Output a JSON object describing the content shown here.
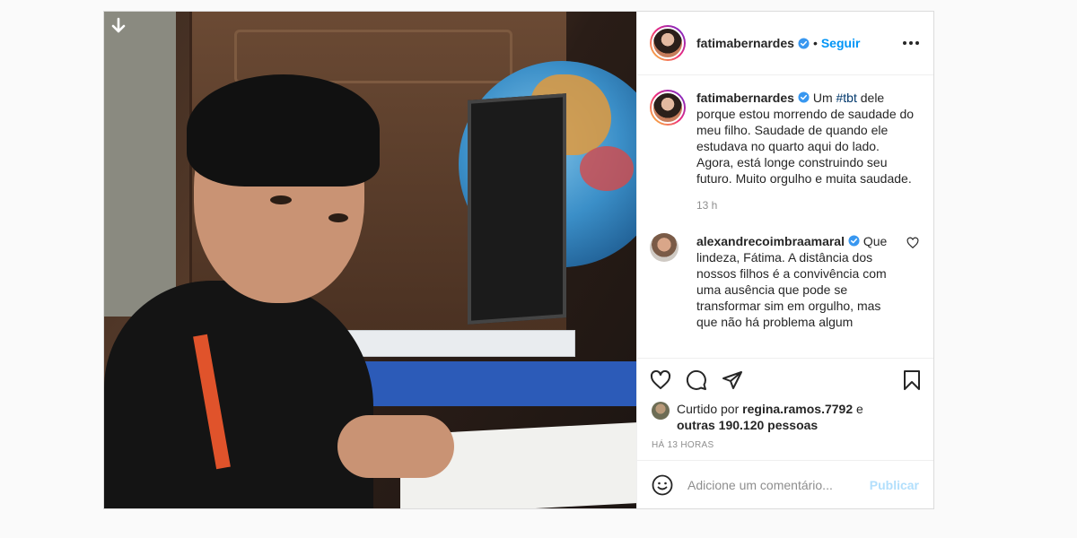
{
  "post": {
    "author": {
      "username": "fatimabernardes",
      "verified": true,
      "follow_label": "Seguir",
      "separator": "•"
    },
    "caption": {
      "username": "fatimabernardes",
      "text_before_hashtag": " Um ",
      "hashtag": "#tbt",
      "text_after_hashtag": " dele porque estou morrendo de saudade do meu filho. Saudade de quando ele estudava no quarto aqui do lado. Agora, está longe construindo seu futuro. Muito orgulho e muita saudade.",
      "time": "13 h"
    },
    "comments": [
      {
        "username": "alexandrecoimbraamaral",
        "verified": true,
        "text": " Que lindeza, Fátima. A distância dos nossos filhos é a convivência com uma ausência que pode se transformar sim em orgulho, mas que não há problema algum"
      }
    ],
    "likes": {
      "prefix": "Curtido por ",
      "user": "regina.ramos.7792",
      "connector": " e",
      "others": "outras 190.120 pessoas"
    },
    "posted_ago": "HÁ 13 HORAS",
    "add_comment": {
      "placeholder": "Adicione um comentário...",
      "publish_label": "Publicar"
    }
  },
  "colors": {
    "link_blue": "#0095f6",
    "hashtag_blue": "#00376b",
    "publish_disabled": "#b2dffc",
    "verified_blue": "#3897f0"
  },
  "icons": {
    "download": "download-arrow-icon",
    "more": "more-options-icon",
    "like": "heart-icon",
    "comment": "comment-bubble-icon",
    "share": "paper-plane-icon",
    "save": "bookmark-icon",
    "emoji": "emoji-icon"
  }
}
